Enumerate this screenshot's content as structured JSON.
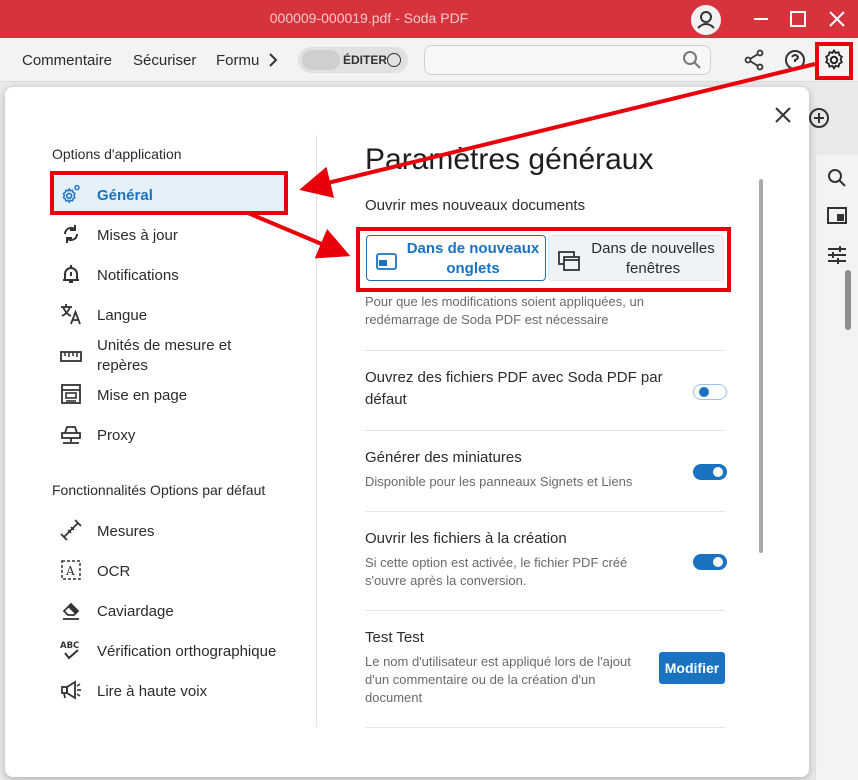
{
  "window": {
    "title": "000009-000019.pdf   -   Soda PDF"
  },
  "toolbar": {
    "menu": [
      "Commentaire",
      "Sécuriser",
      "Formu"
    ],
    "edit_label": "ÉDITER",
    "search_placeholder": ""
  },
  "dialog": {
    "sidebar": {
      "section1": "Options d'application",
      "app_items": [
        {
          "label": "Général",
          "icon": "gear-icon"
        },
        {
          "label": "Mises à jour",
          "icon": "sync-icon"
        },
        {
          "label": "Notifications",
          "icon": "bell-icon"
        },
        {
          "label": "Langue",
          "icon": "translate-icon"
        },
        {
          "label": "Unités de mesure et repères",
          "icon": "ruler-icon"
        },
        {
          "label": "Mise en page",
          "icon": "layout-icon"
        },
        {
          "label": "Proxy",
          "icon": "proxy-icon"
        }
      ],
      "section2": "Fonctionnalités Options par défaut",
      "feature_items": [
        {
          "label": "Mesures",
          "icon": "measure-icon"
        },
        {
          "label": "OCR",
          "icon": "ocr-icon"
        },
        {
          "label": "Caviardage",
          "icon": "eraser-icon"
        },
        {
          "label": "Vérification orthographique",
          "icon": "spellcheck-icon"
        },
        {
          "label": "Lire à haute voix",
          "icon": "megaphone-icon"
        }
      ]
    },
    "main": {
      "title": "Paramètres généraux",
      "open_docs_label": "Ouvrir mes nouveaux documents",
      "option_tabs": "Dans de nouveaux onglets",
      "option_windows": "Dans de nouvelles fenêtres",
      "restart_note": "Pour que les modifications soient appliquées, un redémarrage de Soda PDF est nécessaire",
      "settings": [
        {
          "title": "Ouvrez des fichiers PDF avec Soda PDF par défaut",
          "desc": "",
          "enabled": false
        },
        {
          "title": "Générer des miniatures",
          "desc": "Disponible pour les panneaux Signets et Liens",
          "enabled": true
        },
        {
          "title": "Ouvrir les fichiers à la création",
          "desc": "Si cette option est activée, le fichier PDF créé s'ouvre après la conversion.",
          "enabled": true
        }
      ],
      "user": {
        "name": "Test Test",
        "desc": "Le nom d'utilisateur est appliqué lors de l'ajout d'un commentaire ou de la création d'un document",
        "button": "Modifier"
      }
    }
  },
  "colors": {
    "titlebar": "#d7333d",
    "accent": "#1a73c1",
    "annotation": "#e8000b"
  }
}
